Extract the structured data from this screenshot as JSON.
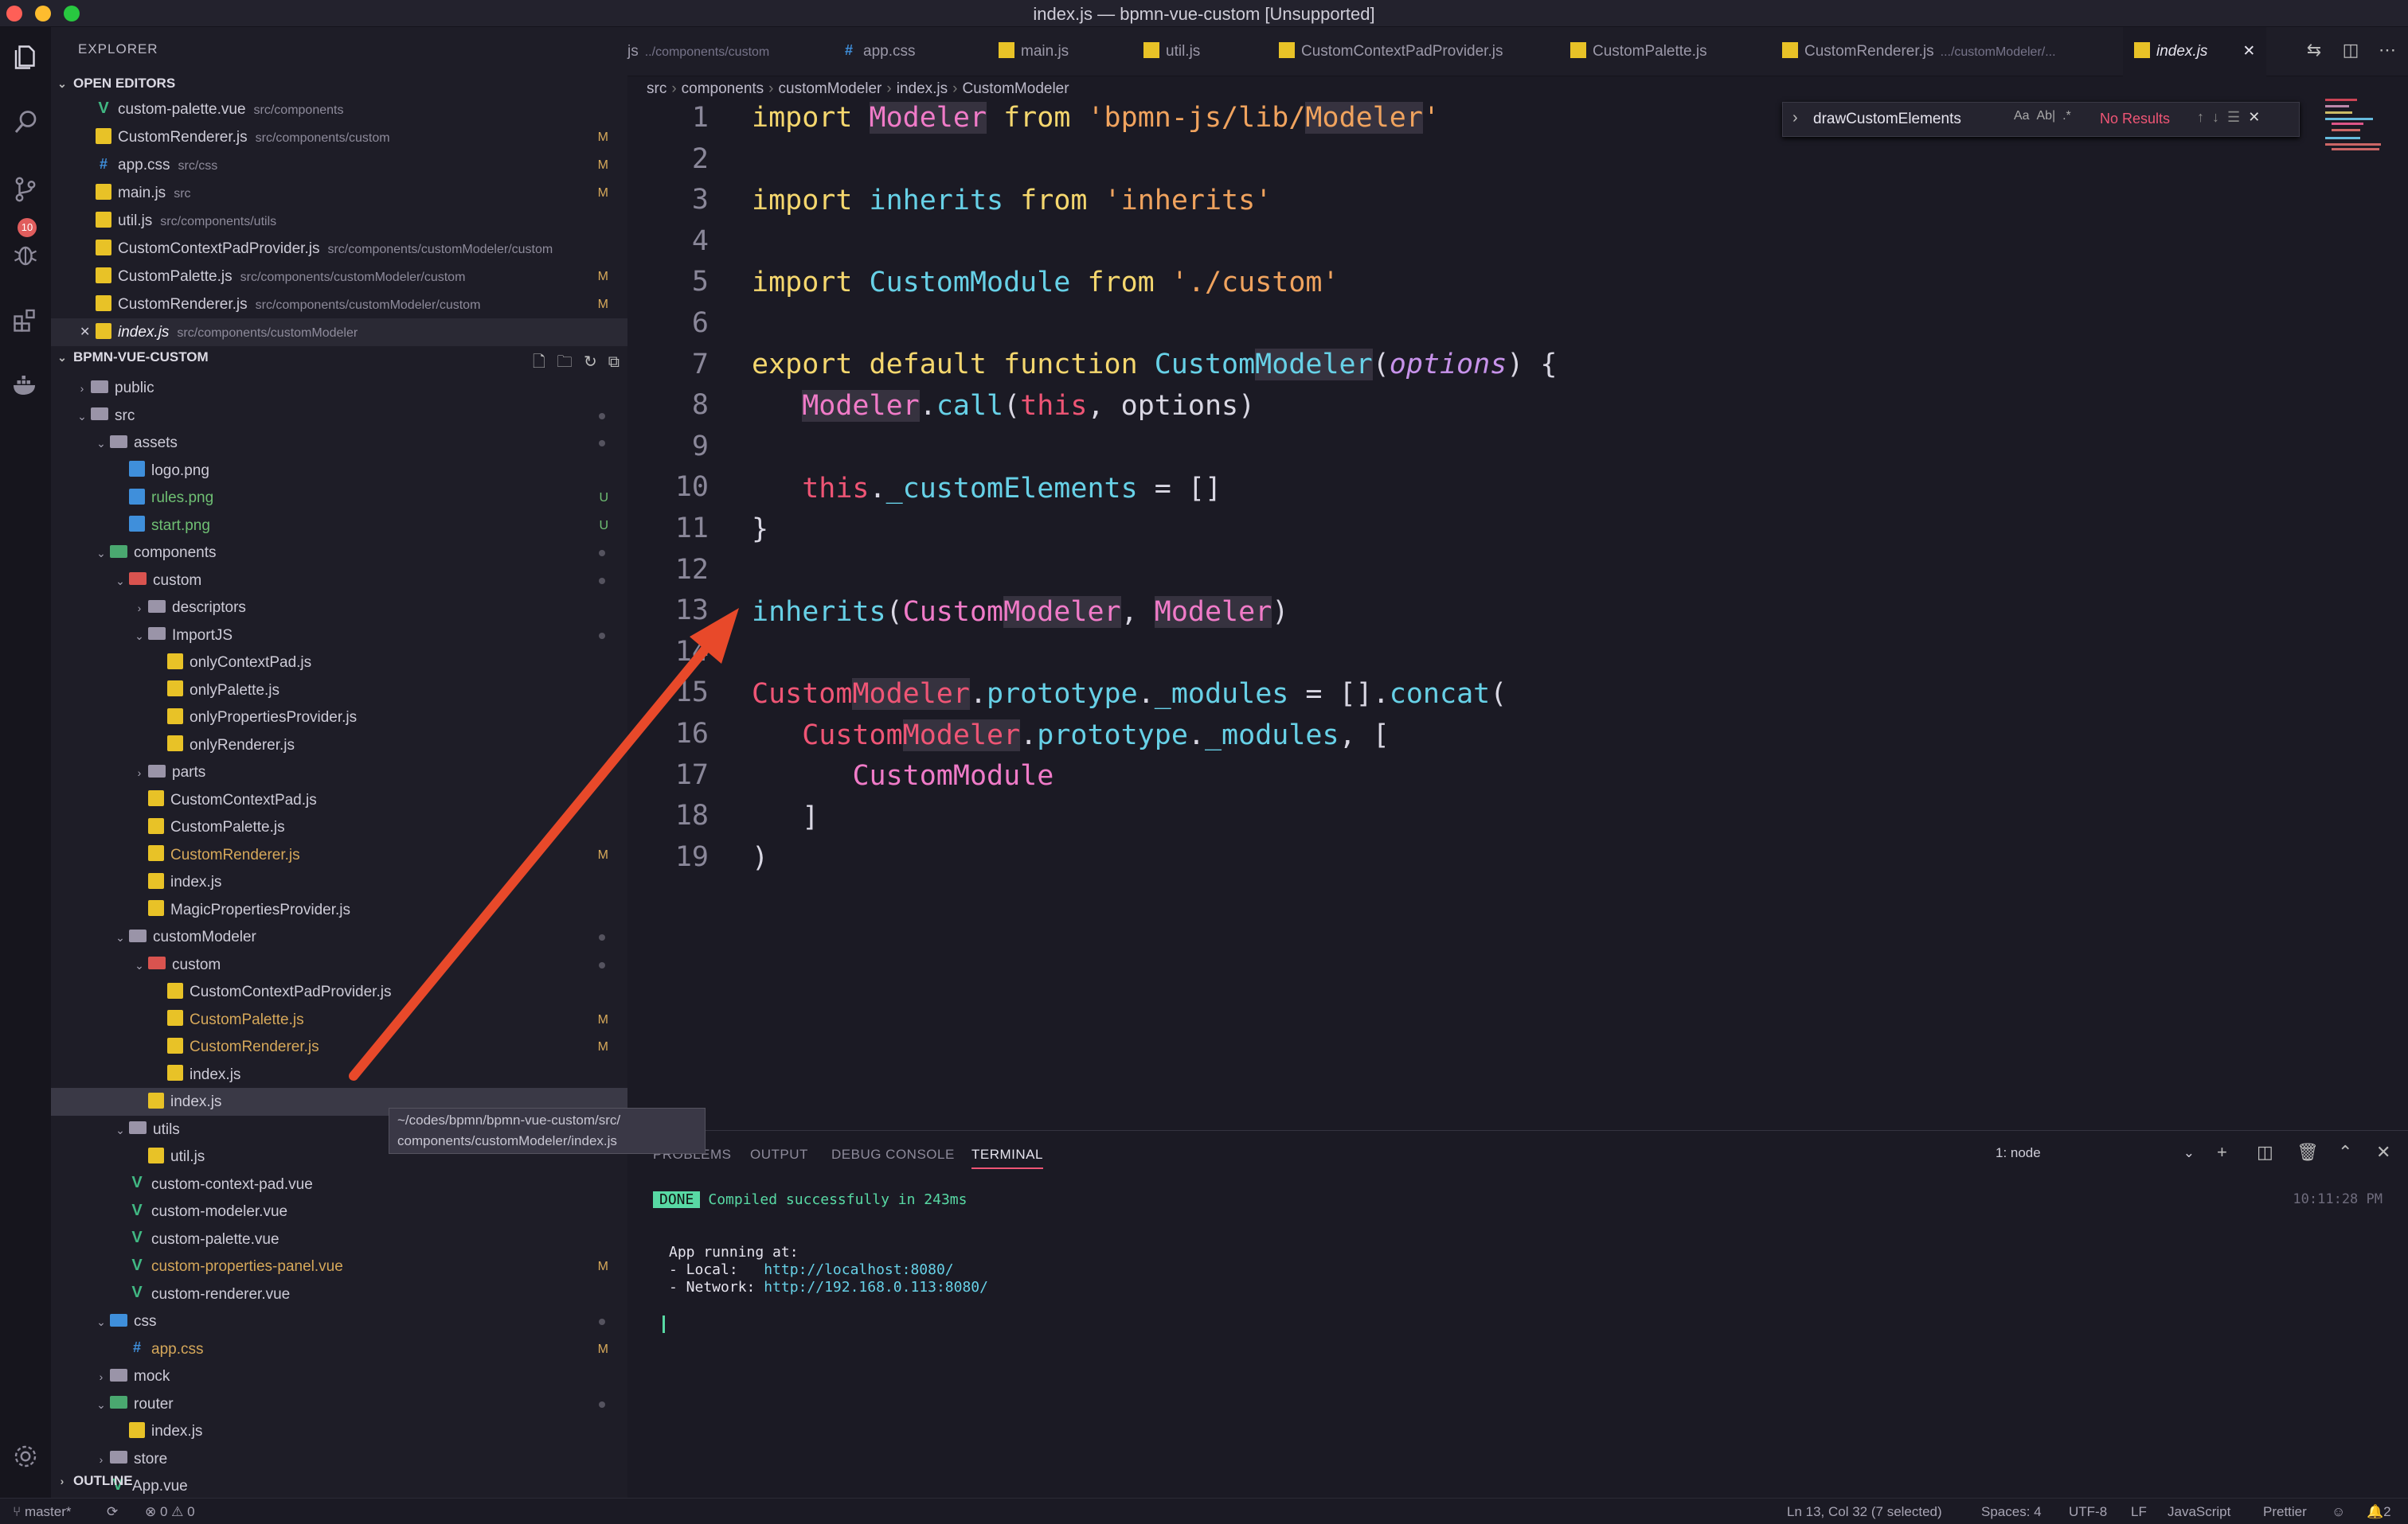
{
  "window": {
    "title": "index.js — bpmn-vue-custom [Unsupported]"
  },
  "sidebar": {
    "title": "EXPLORER",
    "open_editors_label": "OPEN EDITORS",
    "open_editors": [
      {
        "name": "custom-palette.vue",
        "path": "src/components",
        "type": "vue",
        "status": ""
      },
      {
        "name": "CustomRenderer.js",
        "path": "src/components/custom",
        "type": "js",
        "status": "M"
      },
      {
        "name": "app.css",
        "path": "src/css",
        "type": "css",
        "status": "M"
      },
      {
        "name": "main.js",
        "path": "src",
        "type": "js",
        "status": "M"
      },
      {
        "name": "util.js",
        "path": "src/components/utils",
        "type": "js",
        "status": ""
      },
      {
        "name": "CustomContextPadProvider.js",
        "path": "src/components/customModeler/custom",
        "type": "js",
        "status": ""
      },
      {
        "name": "CustomPalette.js",
        "path": "src/components/customModeler/custom",
        "type": "js",
        "status": "M"
      },
      {
        "name": "CustomRenderer.js",
        "path": "src/components/customModeler/custom",
        "type": "js",
        "status": "M"
      },
      {
        "name": "index.js",
        "path": "src/components/customModeler",
        "type": "js",
        "status": ""
      }
    ],
    "project_label": "BPMN-VUE-CUSTOM",
    "tree": [
      {
        "name": "public",
        "depth": 1,
        "kind": "folder",
        "open": false
      },
      {
        "name": "src",
        "depth": 1,
        "kind": "folder",
        "open": true
      },
      {
        "name": "assets",
        "depth": 2,
        "kind": "folder",
        "open": true,
        "color": "y"
      },
      {
        "name": "logo.png",
        "depth": 3,
        "kind": "png"
      },
      {
        "name": "rules.png",
        "depth": 3,
        "kind": "png",
        "status": "U"
      },
      {
        "name": "start.png",
        "depth": 3,
        "kind": "png",
        "status": "U"
      },
      {
        "name": "components",
        "depth": 2,
        "kind": "folder",
        "open": true,
        "color": "g"
      },
      {
        "name": "custom",
        "depth": 3,
        "kind": "folder",
        "open": true,
        "color": "r"
      },
      {
        "name": "descriptors",
        "depth": 4,
        "kind": "folder",
        "open": false
      },
      {
        "name": "ImportJS",
        "depth": 4,
        "kind": "folder",
        "open": true
      },
      {
        "name": "onlyContextPad.js",
        "depth": 5,
        "kind": "js"
      },
      {
        "name": "onlyPalette.js",
        "depth": 5,
        "kind": "js"
      },
      {
        "name": "onlyPropertiesProvider.js",
        "depth": 5,
        "kind": "js"
      },
      {
        "name": "onlyRenderer.js",
        "depth": 5,
        "kind": "js"
      },
      {
        "name": "parts",
        "depth": 4,
        "kind": "folder",
        "open": false
      },
      {
        "name": "CustomContextPad.js",
        "depth": 4,
        "kind": "js"
      },
      {
        "name": "CustomPalette.js",
        "depth": 4,
        "kind": "js"
      },
      {
        "name": "CustomRenderer.js",
        "depth": 4,
        "kind": "js",
        "status": "M"
      },
      {
        "name": "index.js",
        "depth": 4,
        "kind": "js"
      },
      {
        "name": "MagicPropertiesProvider.js",
        "depth": 4,
        "kind": "js"
      },
      {
        "name": "customModeler",
        "depth": 3,
        "kind": "folder",
        "open": true
      },
      {
        "name": "custom",
        "depth": 4,
        "kind": "folder",
        "open": true,
        "color": "r"
      },
      {
        "name": "CustomContextPadProvider.js",
        "depth": 5,
        "kind": "js"
      },
      {
        "name": "CustomPalette.js",
        "depth": 5,
        "kind": "js",
        "status": "M"
      },
      {
        "name": "CustomRenderer.js",
        "depth": 5,
        "kind": "js",
        "status": "M"
      },
      {
        "name": "index.js",
        "depth": 5,
        "kind": "js"
      },
      {
        "name": "index.js",
        "depth": 4,
        "kind": "js",
        "selected": true
      },
      {
        "name": "utils",
        "depth": 3,
        "kind": "folder",
        "open": true
      },
      {
        "name": "util.js",
        "depth": 4,
        "kind": "js"
      },
      {
        "name": "custom-context-pad.vue",
        "depth": 3,
        "kind": "vue"
      },
      {
        "name": "custom-modeler.vue",
        "depth": 3,
        "kind": "vue"
      },
      {
        "name": "custom-palette.vue",
        "depth": 3,
        "kind": "vue"
      },
      {
        "name": "custom-properties-panel.vue",
        "depth": 3,
        "kind": "vue",
        "status": "M"
      },
      {
        "name": "custom-renderer.vue",
        "depth": 3,
        "kind": "vue"
      },
      {
        "name": "css",
        "depth": 2,
        "kind": "folder",
        "open": true,
        "color": "b"
      },
      {
        "name": "app.css",
        "depth": 3,
        "kind": "css",
        "status": "M"
      },
      {
        "name": "mock",
        "depth": 2,
        "kind": "folder",
        "open": false
      },
      {
        "name": "router",
        "depth": 2,
        "kind": "folder",
        "open": true,
        "color": "g"
      },
      {
        "name": "index.js",
        "depth": 3,
        "kind": "js"
      },
      {
        "name": "store",
        "depth": 2,
        "kind": "folder",
        "open": false
      },
      {
        "name": "App.vue",
        "depth": 2,
        "kind": "vue"
      }
    ],
    "outline_label": "OUTLINE",
    "tooltip_line1": "~/codes/bpmn/bpmn-vue-custom/src/",
    "tooltip_line2": "components/customModeler/index.js",
    "scm_badge": "10"
  },
  "tabs": [
    {
      "label": "js",
      "dim": "../components/custom",
      "type": "js"
    },
    {
      "label": "app.css",
      "dim": "",
      "type": "css"
    },
    {
      "label": "main.js",
      "dim": "",
      "type": "js"
    },
    {
      "label": "util.js",
      "dim": "",
      "type": "js"
    },
    {
      "label": "CustomContextPadProvider.js",
      "dim": "",
      "type": "js"
    },
    {
      "label": "CustomPalette.js",
      "dim": "",
      "type": "js"
    },
    {
      "label": "CustomRenderer.js",
      "dim": ".../customModeler/...",
      "type": "js"
    },
    {
      "label": "index.js",
      "dim": "",
      "type": "js",
      "active": true
    }
  ],
  "breadcrumb": [
    "src",
    "components",
    "customModeler",
    "index.js",
    "CustomModeler"
  ],
  "editor": {
    "line_numbers": [
      "1",
      "2",
      "3",
      "4",
      "5",
      "6",
      "7",
      "8",
      "9",
      "10",
      "11",
      "12",
      "13",
      "14",
      "15",
      "16",
      "17",
      "18",
      "19"
    ]
  },
  "find": {
    "value": "drawCustomElements",
    "result": "No Results",
    "opt_case": "Aa",
    "opt_word": "Ab|",
    "opt_regex": ".*"
  },
  "panel": {
    "tabs": [
      "PROBLEMS",
      "OUTPUT",
      "DEBUG CONSOLE",
      "TERMINAL"
    ],
    "terminal_select": "1: node",
    "time": "10:11:28 PM",
    "done_badge": "DONE",
    "compiled": "Compiled successfully in 243ms",
    "app_running": "App running at:",
    "local_label": "- Local:   ",
    "local_url": "http://localhost:8080/",
    "network_label": "- Network: ",
    "network_url": "http://192.168.0.113:8080/"
  },
  "status": {
    "branch": "master*",
    "problems": "⊗ 0 ⚠ 0",
    "cursor": "Ln 13, Col 32 (7 selected)",
    "spaces": "Spaces: 4",
    "encoding": "UTF-8",
    "eol": "LF",
    "language": "JavaScript",
    "formatter": "Prettier",
    "notifications": "2"
  },
  "colors": {
    "accent": "#ef5575",
    "keyword": "#f5d76e",
    "string": "#f0a35e",
    "func": "#67d1e7",
    "type": "#f07bc8",
    "annotation_arrow": "#e8492a"
  }
}
